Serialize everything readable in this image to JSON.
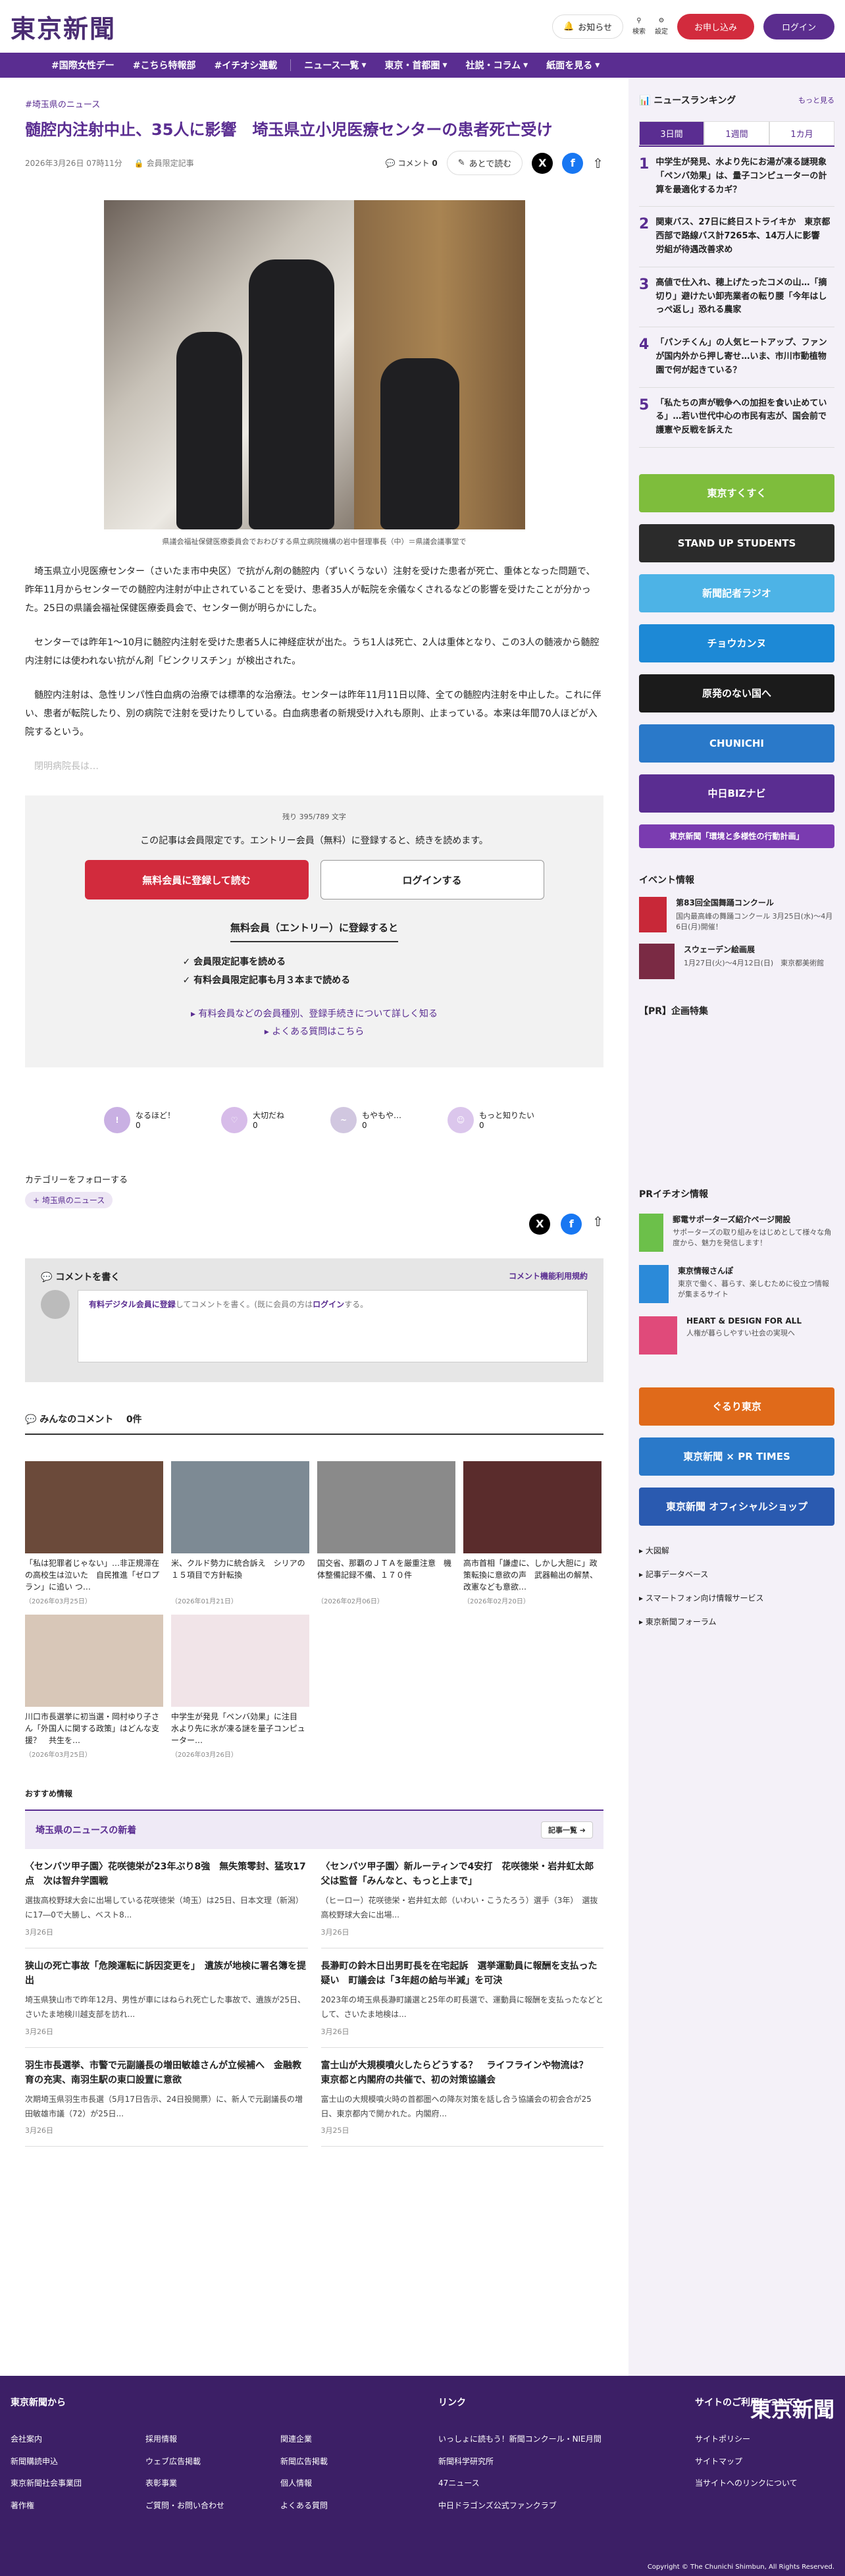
{
  "header": {
    "logo": "東京新聞",
    "notice": "お知らせ",
    "search": "検索",
    "settings": "設定",
    "apply": "お申し込み",
    "login": "ログイン"
  },
  "nav": {
    "items": [
      "#国際女性デー",
      "#こちら特報部",
      "#イチオシ連載",
      "ニュース一覧",
      "東京・首都圏",
      "社説・コラム",
      "紙面を見る"
    ]
  },
  "article": {
    "breadcrumb": "#埼玉県のニュース",
    "title": "髄腔内注射中止、35人に影響　埼玉県立小児医療センターの患者死亡受け",
    "date": "2026年3月26日 07時11分",
    "members_only": "会員限定記事",
    "comment_label": "コメント",
    "comment_count": "0",
    "read_later": "あとで読む",
    "caption": "県議会福祉保健医療委員会でおわびする県立病院機構の岩中督理事長（中）＝県議会議事堂で",
    "paragraphs": [
      "埼玉県立小児医療センター（さいたま市中央区）で抗がん剤の髄腔内（ずいくうない）注射を受けた患者が死亡、重体となった問題で、昨年11月からセンターでの髄腔内注射が中止されていることを受け、患者35人が転院を余儀なくされるなどの影響を受けたことが分かった。25日の県議会福祉保健医療委員会で、センター側が明らかにした。",
      "センターでは昨年1〜10月に髄腔内注射を受けた患者5人に神経症状が出た。うち1人は死亡、2人は重体となり、この3人の髄液から髄腔内注射には使われない抗がん剤「ビンクリスチン」が検出された。",
      "髄腔内注射は、急性リンパ性白血病の治療では標準的な治療法。センターは昨年11月11日以降、全ての髄腔内注射を中止した。これに伴い、患者が転院したり、別の病院で注射を受けたりしている。白血病患者の新規受け入れも原則、止まっている。本来は年間70人ほどが入院するという。"
    ],
    "faded": "閉明病院長は…"
  },
  "paywall": {
    "remaining": "残り 395/789 文字",
    "message": "この記事は会員限定です。エントリー会員（無料）に登録すると、続きを読めます。",
    "register": "無料会員に登録して読む",
    "login": "ログインする",
    "free_title": "無料会員（エントリー）に登録すると",
    "benefits": [
      "会員限定記事を読める",
      "有料会員限定記事も月３本まで読める"
    ],
    "links": [
      "有料会員などの会員種別、登録手続きについて詳しく知る",
      "よくある質問はこちら"
    ]
  },
  "reactions": [
    {
      "label": "なるほど！",
      "count": "0"
    },
    {
      "label": "大切だね",
      "count": "0"
    },
    {
      "label": "もやもや…",
      "count": "0"
    },
    {
      "label": "もっと知りたい",
      "count": "0"
    }
  ],
  "follow": {
    "label": "カテゴリーをフォローする",
    "tag": "埼玉県のニュース"
  },
  "comment_form": {
    "title": "コメントを書く",
    "rules": "コメント機能利用規約",
    "prefix_link": "有料デジタル会員に登録",
    "middle": "してコメントを書く。(既に会員の方は",
    "login": "ログイン",
    "suffix": "する。"
  },
  "all_comments": {
    "title": "みんなのコメント",
    "count": "0件"
  },
  "thumbs": [
    {
      "title": "「私は犯罪者じゃない」…非正規滞在の高校生は泣いた　自民推進「ゼロプラン」に追い つ…",
      "date": "（2026年03月25日）",
      "color": "#6b4a3a"
    },
    {
      "title": "米、クルド勢力に統合訴え　シリアの１５項目で方針転換",
      "date": "（2026年01月21日）",
      "color": "#7d8a94"
    },
    {
      "title": "国交省、那覇のＪＴＡを厳重注意　機体整備記録不備、１７０件",
      "date": "（2026年02月06日）",
      "color": "#8a8a8a"
    },
    {
      "title": "高市首相「謙虚に、しかし大胆に」政策転換に意欲の声　武器輸出の解禁、改憲なども意欲…",
      "date": "（2026年02月20日）",
      "color": "#5a2c2c"
    },
    {
      "title": "川口市長選挙に初当選・岡村ゆり子さん「外国人に関する政策」はどんな支援？　共生を…",
      "date": "（2026年03月25日）",
      "color": "#d8c7b8"
    },
    {
      "title": "中学生が発見「ペンバ効果」に注目　水より先に氷が凍る謎を量子コンピューター…",
      "date": "（2026年03月26日）",
      "color": "#f1e4e8"
    }
  ],
  "recommend": "おすすめ情報",
  "related": {
    "title": "埼玉県のニュースの新着",
    "more": "記事一覧",
    "items": [
      {
        "title": "〈センバツ甲子園〉花咲徳栄が23年ぶり8強　無失策零封、猛攻17点　次は智弁学園戦",
        "summary": "選抜高校野球大会に出場している花咲徳栄（埼玉）は25日、日本文理（新潟）に17―0で大勝し、ベスト8...",
        "date": "3月26日"
      },
      {
        "title": "〈センバツ甲子園〉新ルーティンで4安打　花咲徳栄・岩井虹太郎　父は監督「みんなと、もっと上まで」",
        "summary": "（ヒーロー）花咲徳栄・岩井虹太郎（いわい・こうたろう）選手（3年）　選抜高校野球大会に出場...",
        "date": "3月26日"
      },
      {
        "title": "狭山の死亡事故「危険運転に訴因変更を」　遺族が地検に署名簿を提出",
        "summary": "埼玉県狭山市で昨年12月、男性が車にはねられ死亡した事故で、遺族が25日、さいたま地検川越支部を訪れ...",
        "date": "3月26日"
      },
      {
        "title": "長瀞町の鈴木日出男町長を在宅起訴　選挙運動員に報酬を支払った疑い　町議会は「3年超の給与半減」を可決",
        "summary": "2023年の埼玉県長瀞町議選と25年の町長選で、運動員に報酬を支払ったなどとして、さいたま地検は...",
        "date": "3月26日"
      },
      {
        "title": "羽生市長選挙、市警で元副議長の増田敏雄さんが立候補へ　金融教育の充実、南羽生駅の東口設置に意欲",
        "summary": "次期埼玉県羽生市長選（5月17日告示、24日投開票）に、新人で元副議長の増田敏雄市議（72）が25日...",
        "date": "3月26日"
      },
      {
        "title": "富士山が大規模噴火したらどうする？　ライフラインや物流は？　東京都と内閣府の共催で、初の対策協議会",
        "summary": "富士山の大規模噴火時の首都圏への降灰対策を話し合う協議会の初会合が25日、東京都内で開かれた。内閣府...",
        "date": "3月25日"
      }
    ]
  },
  "sidebar": {
    "ranking_title": "ニュースランキング",
    "ranking_more": "もっと見る",
    "tabs": [
      "3日間",
      "1週間",
      "1カ月"
    ],
    "ranking": [
      "中学生が発見、水より先にお湯が凍る謎現象「ペンバ効果」は、量子コンピューターの計算を最適化するカギ？",
      "関東バス、27日に終日ストライキか　東京都西部で路線バス計7265本、14万人に影響　労組が待遇改善求め",
      "高値で仕入れ、穂上げたったコメの山…「摘切り」避けたい卸売業者の転り腰「今年はしっぺ返し」恐れる農家",
      "「パンチくん」の人気ヒートアップ、ファンが国内外から押し寄せ…いま、市川市動植物園で何が起きている？",
      "「私たちの声が戦争への加担を食い止めている」…若い世代中心の市民有志が、国会前で護憲や反戦を訴えた"
    ],
    "banners": [
      {
        "label": "東京すくすく",
        "color": "#7ebd3c"
      },
      {
        "label": "STAND UP STUDENTS",
        "color": "#2b2b2b"
      },
      {
        "label": "新聞記者ラジオ",
        "color": "#4db3e6"
      },
      {
        "label": "チョウカンヌ",
        "color": "#1d89d6"
      },
      {
        "label": "原発のない国へ",
        "color": "#1b1b1b"
      },
      {
        "label": "CHUNICHI",
        "color": "#2a79c9"
      },
      {
        "label": "中日BIZナビ",
        "color": "#5a2d91"
      },
      {
        "label": "東京新聞「環境と多様性の行動計画」",
        "color": "#7a3bb0"
      }
    ],
    "events_title": "イベント情報",
    "events": [
      {
        "title": "第83回全国舞踊コンクール",
        "sub": "国内最高峰の舞踊コンクール 3月25日(水)〜4月6日(月)開催！",
        "color": "#c82838"
      },
      {
        "title": "スウェーデン絵画展",
        "sub": "1月27日(火)〜4月12日(日)　東京都美術館",
        "color": "#7a2a44"
      }
    ],
    "pr_title": "【PR】企画特集",
    "pr2_title": "PRイチオシ情報",
    "pr_items": [
      {
        "title": "郵電サポーターズ紹介ページ開設",
        "sub": "サポーターズの取り組みをはじめとして様々な角度から、魅力を発信します！",
        "color": "#6cc04a"
      },
      {
        "title": "東京情報さんぽ",
        "sub": "東京で働く、暮らす、楽しむために役立つ情報が集まるサイト",
        "color": "#2b8ad9"
      },
      {
        "title": "HEART & DESIGN FOR ALL",
        "sub": "人権が暮らしやすい社会の実現へ",
        "color": "#e04a7a"
      }
    ],
    "banners2": [
      {
        "label": "ぐるり東京",
        "color": "#e06a1a"
      },
      {
        "label": "東京新聞 × PR TIMES",
        "color": "#2a79c9"
      },
      {
        "label": "東京新聞 オフィシャルショップ",
        "color": "#2a5ab0"
      }
    ],
    "links": [
      "大図解",
      "記事データベース",
      "スマートフォン向け情報サービス",
      "東京新聞フォーラム"
    ]
  },
  "footer": {
    "col1_title": "東京新聞から",
    "col1": [
      [
        "会社案内",
        "新聞購読申込",
        "東京新聞社会事業団",
        "著作権"
      ],
      [
        "採用情報",
        "ウェブ広告掲載",
        "表彰事業",
        "ご質問・お問い合わせ"
      ],
      [
        "関連企業",
        "新聞広告掲載",
        "個人情報",
        "よくある質問"
      ]
    ],
    "col2_title": "リンク",
    "col2": [
      "いっしょに読もう！新聞コンクール・NIE月間",
      "新聞科学研究所",
      "47ニュース",
      "中日ドラゴンズ公式ファンクラブ"
    ],
    "col3_title": "サイトのご利用について",
    "col3": [
      "サイトポリシー",
      "サイトマップ",
      "当サイトへのリンクについて"
    ],
    "logo": "東京新聞",
    "copyright": "Copyright © The Chunichi Shimbun, All Rights Reserved."
  }
}
